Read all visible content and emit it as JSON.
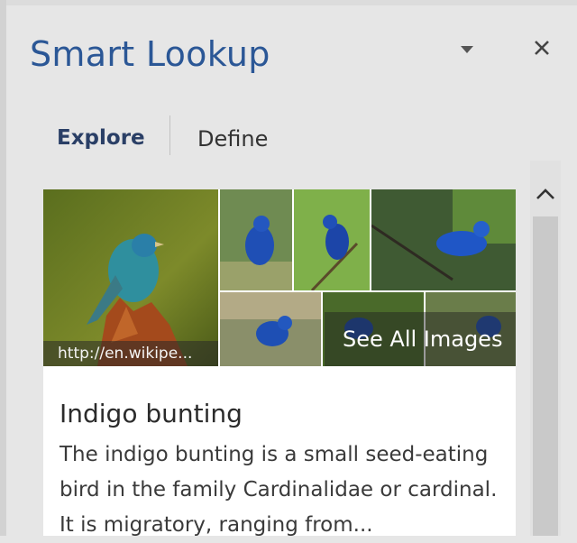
{
  "pane": {
    "title": "Smart Lookup",
    "dropdown_icon": "chevron-down-icon",
    "close_icon": "close-icon"
  },
  "tabs": [
    {
      "label": "Explore",
      "active": true
    },
    {
      "label": "Define",
      "active": false
    }
  ],
  "images": {
    "source_caption": "http://en.wikipe...",
    "see_all_label": "See All Images",
    "subject": "indigo bunting bird photos"
  },
  "result": {
    "title": "Indigo bunting",
    "description": "The indigo bunting is a small seed-eating bird in the family Cardinalidae or cardinal. It is migratory, ranging from..."
  },
  "scrollbar": {
    "up_icon": "chevron-up-icon"
  },
  "colors": {
    "title_blue": "#2b5796",
    "active_tab": "#2a3f66",
    "pane_bg": "#e6e6e6",
    "bird_blue": "#1f4fb5"
  }
}
